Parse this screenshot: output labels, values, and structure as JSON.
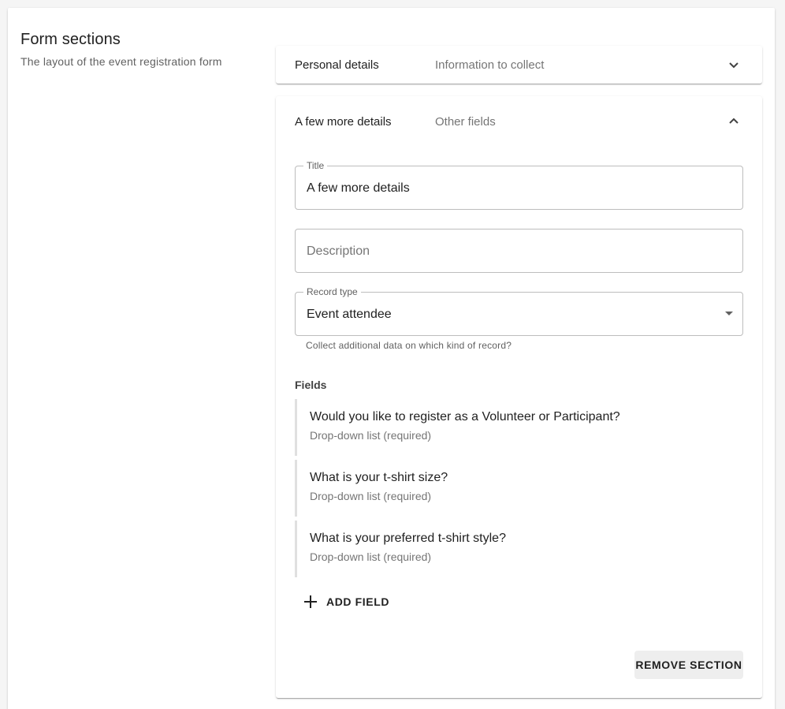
{
  "section": {
    "title": "Form sections",
    "description": "The layout of the event registration form"
  },
  "panels": [
    {
      "name": "Personal details",
      "subtitle": "Information to collect",
      "expanded": false,
      "icon": "chevron-down-icon"
    },
    {
      "name": "A few more details",
      "subtitle": "Other fields",
      "expanded": true,
      "icon": "chevron-up-icon",
      "form": {
        "title": {
          "label": "Title",
          "value": "A few more details"
        },
        "description": {
          "placeholder": "Description",
          "value": ""
        },
        "record_type": {
          "label": "Record type",
          "value": "Event attendee",
          "helper": "Collect additional data on which kind of record?"
        }
      },
      "fields_label": "Fields",
      "fields": [
        {
          "question": "Would you like to register as a Volunteer or Participant?",
          "type": "Drop-down list (required)"
        },
        {
          "question": "What is your t-shirt size?",
          "type": "Drop-down list (required)"
        },
        {
          "question": "What is your preferred t-shirt style?",
          "type": "Drop-down list (required)"
        }
      ],
      "add_field_label": "ADD FIELD",
      "remove_section_label": "REMOVE SECTION"
    }
  ],
  "colors": {
    "background": "#f5f5f5",
    "surface": "#ffffff",
    "text_primary": "#212121",
    "text_secondary": "#757575",
    "border": "#bdbdbd",
    "button_bg": "#eeeeee"
  }
}
